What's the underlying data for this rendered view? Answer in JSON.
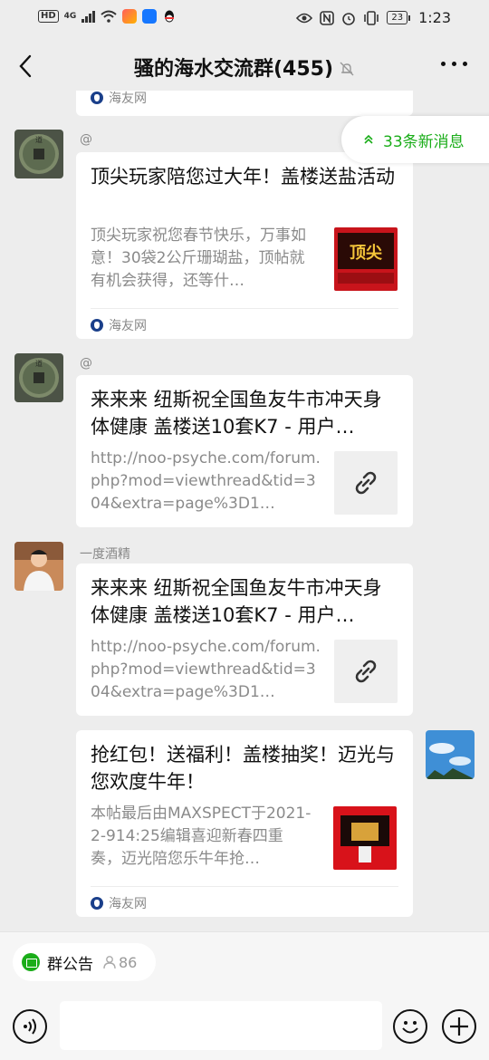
{
  "status_bar": {
    "hd": "HD",
    "signal": "4G",
    "battery": "23",
    "time": "1:23"
  },
  "header": {
    "title": "骚的海水交流群(455)"
  },
  "new_messages": {
    "label": "33条新消息"
  },
  "messages": [
    {
      "source": "海友网"
    },
    {
      "sender": "@",
      "title": "顶尖玩家陪您过大年！盖楼送盐活动",
      "desc": "顶尖玩家祝您春节快乐，万事如意！30袋2公斤珊瑚盐，顶帖就有机会获得，还等什…",
      "source": "海友网"
    },
    {
      "sender": "@",
      "title": "来来来 纽斯祝全国鱼友牛市冲天身体健康 盖楼送10套K7 - 用户…",
      "desc": "http://noo-psyche.com/forum.php?mod=viewthread&tid=304&extra=page%3D1…"
    },
    {
      "sender": "一度酒精",
      "title": "来来来 纽斯祝全国鱼友牛市冲天身体健康 盖楼送10套K7 - 用户…",
      "desc": "http://noo-psyche.com/forum.php?mod=viewthread&tid=304&extra=page%3D1…"
    },
    {
      "title": "抢红包！送福利！盖楼抽奖！迈光与您欢度牛年！",
      "desc": "本帖最后由MAXSPECT于2021-2-914:25编辑喜迎新春四重奏，迈光陪您乐牛年抢…",
      "source": "海友网"
    }
  ],
  "group_notice": {
    "label": "群公告",
    "count": "86"
  },
  "input": {
    "placeholder": ""
  },
  "colors": {
    "accent": "#1aad19",
    "background": "#ededed"
  }
}
